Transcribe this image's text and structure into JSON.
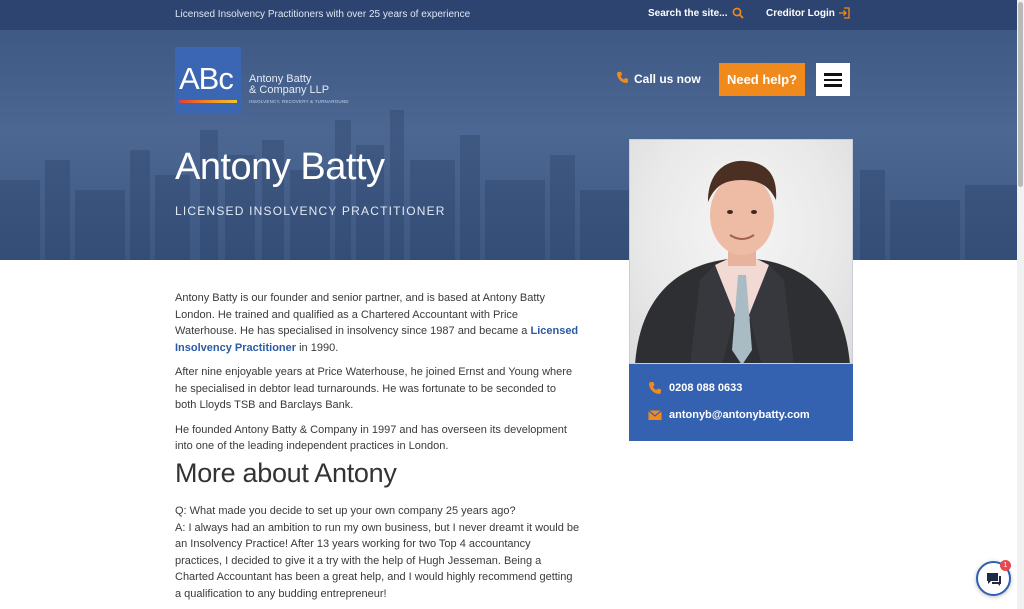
{
  "topbar": {
    "tagline": "Licensed Insolvency Practitioners with over 25 years of experience",
    "search_label": "Search the site...",
    "login_label": "Creditor Login"
  },
  "logo": {
    "letters": "ABc",
    "name_line1": "Antony Batty",
    "name_line2": "& Company LLP",
    "subtitle": "INSOLVENCY, RECOVERY & TURNAROUND"
  },
  "header": {
    "call_label": "Call us now",
    "help_label": "Need help?"
  },
  "hero": {
    "title": "Antony Batty",
    "subtitle": "LICENSED INSOLVENCY PRACTITIONER"
  },
  "profile": {
    "phone": "0208 088 0633",
    "email": "antonyb@antonybatty.com"
  },
  "content": {
    "p1_before": "Antony Batty is our founder and senior partner, and is based at Antony Batty London. He trained and qualified as a Chartered Accountant with Price Waterhouse. He has specialised in insolvency since 1987 and became a ",
    "p1_link": "Licensed Insolvency Practitioner",
    "p1_after": " in 1990.",
    "p2": "After nine enjoyable years at Price Waterhouse, he joined Ernst and Young where he specialised in debtor lead turnarounds. He was fortunate to be seconded to both Lloyds TSB and Barclays Bank.",
    "p3": "He founded Antony Batty & Company in 1997 and has overseen its development into one of the leading independent practices in London.",
    "section_title": "More about Antony",
    "question": "Q: What made you decide to set up your own company 25 years ago?",
    "answer": "A: I always had an ambition to run my own business, but I never dreamt it would be an Insolvency Practice! After 13 years working for two Top 4 accountancy practices, I decided to give it a try with the help of Hugh Jesseman. Being a Charted Accountant has been a great help, and I would highly recommend getting a qualification to any budding entrepreneur!"
  },
  "chat": {
    "badge_count": "1"
  },
  "colors": {
    "navy": "#2d4470",
    "brand_blue": "#3561b1",
    "accent_orange": "#f08a1c",
    "link_blue": "#2b5aa5"
  },
  "icons": [
    "search-icon",
    "login-icon",
    "phone-icon",
    "menu-icon",
    "email-icon",
    "chat-icon"
  ]
}
